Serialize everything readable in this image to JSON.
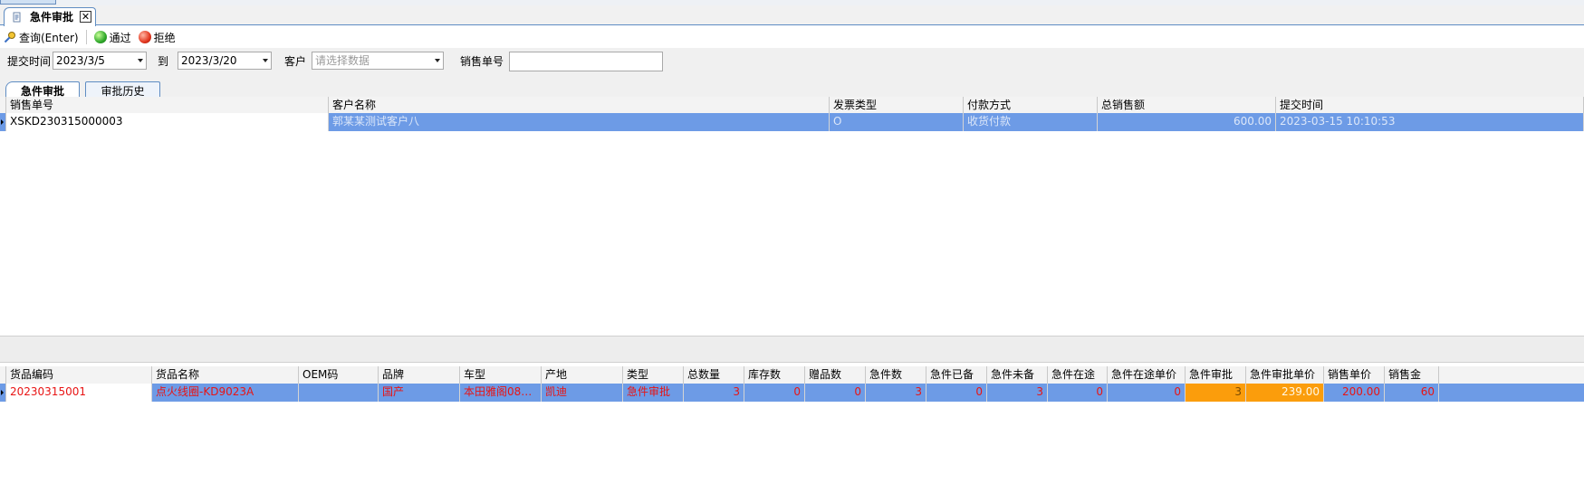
{
  "doc_tab": {
    "title": "急件审批",
    "close": "✕"
  },
  "toolbar": {
    "query_label": "查询(Enter)",
    "approve_label": "通过",
    "reject_label": "拒绝"
  },
  "filter": {
    "submit_time_label": "提交时间",
    "date_from": "2023/3/5",
    "to_label": "到",
    "date_to": "2023/3/20",
    "customer_label": "客户",
    "customer_placeholder": "请选择数据",
    "order_no_label": "销售单号",
    "order_no_value": ""
  },
  "inner_tabs": [
    {
      "label": "急件审批",
      "active": true
    },
    {
      "label": "审批历史",
      "active": false
    }
  ],
  "orders_grid": {
    "headers": [
      "销售单号",
      "客户名称",
      "发票类型",
      "付款方式",
      "总销售额",
      "提交时间"
    ],
    "rows": [
      {
        "order_no": "XSKD230315000003",
        "customer": "郭某某测试客户八",
        "invoice_type": "O",
        "payment": "收货付款",
        "total": "600.00",
        "submit_time": "2023-03-15 10:10:53"
      }
    ]
  },
  "items_grid": {
    "headers": [
      "货品编码",
      "货品名称",
      "OEM码",
      "品牌",
      "车型",
      "产地",
      "类型",
      "总数量",
      "库存数",
      "赠品数",
      "急件数",
      "急件已备",
      "急件未备",
      "急件在途",
      "急件在途单价",
      "急件审批",
      "急件审批单价",
      "销售单价",
      "销售金"
    ],
    "rows": [
      {
        "code": "20230315001",
        "name": "点火线圈-KD9023A",
        "oem": "",
        "brand": "国产",
        "model": "本田雅阁08款…",
        "origin": "凯迪",
        "type": "急件审批",
        "total_qty": "3",
        "stock": "0",
        "gift": "0",
        "urgent": "3",
        "urgent_ready": "0",
        "urgent_unready": "3",
        "urgent_transit": "0",
        "urgent_transit_price": "0",
        "urgent_approve": "3",
        "urgent_approve_price": "239.00",
        "sale_price": "200.00",
        "sale_amount": "60"
      }
    ]
  },
  "colors": {
    "selection": "#6d9be6",
    "highlight_orange": "#fb9d0c",
    "text_red": "#e81414",
    "tab_border": "#5f8dc3"
  },
  "icons": [
    "document-icon",
    "close-icon",
    "search-key-icon",
    "green-ball-icon",
    "red-ball-icon",
    "dropdown-arrow-icon",
    "row-indicator-icon"
  ]
}
